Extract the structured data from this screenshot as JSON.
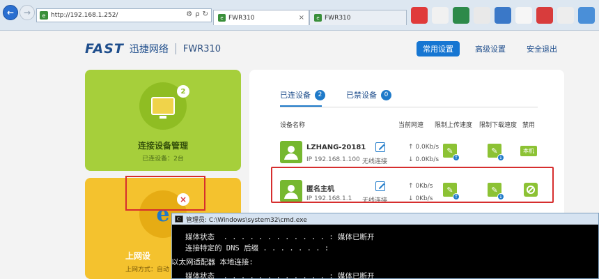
{
  "browser": {
    "address": "http://192.168.1.252/",
    "tabs": [
      {
        "label": "FWR310",
        "active": true
      },
      {
        "label": "FWR310",
        "active": false
      }
    ],
    "address_tools": [
      "⚙",
      "ρ",
      "↻"
    ]
  },
  "header": {
    "logo": "FAST",
    "brand_cn": "迅捷网络",
    "model": "FWR310",
    "nav": [
      "常用设置",
      "高级设置",
      "安全退出"
    ]
  },
  "tiles": {
    "devices": {
      "title": "连接设备管理",
      "subtitle": "已连设备：2台",
      "count": "2"
    },
    "internet": {
      "title": "上网设",
      "subtitle": "上网方式：自动"
    }
  },
  "panel": {
    "tabs": [
      {
        "label": "已连设备",
        "count": "2"
      },
      {
        "label": "已禁设备",
        "count": "0"
      }
    ],
    "columns": [
      "设备名称",
      "当前网速",
      "限制上传速度",
      "限制下载速度",
      "禁用"
    ],
    "rows": [
      {
        "name": "LZHANG-20181",
        "ip": "IP 192.168.1.100",
        "conn": "无线连接",
        "up": "↑ 0.0Kb/s",
        "down": "↓ 0.0Kb/s",
        "status": "本机"
      },
      {
        "name": "匿名主机",
        "ip": "IP 192.168.1.1",
        "conn": "无线连接",
        "up": "↑ 0Kb/s",
        "down": "↓ 0Kb/s",
        "status": ""
      }
    ]
  },
  "cmd": {
    "title": "管理员: C:\\Windows\\system32\\cmd.exe",
    "lines": [
      "   媒体状态  . . . . . . . . . . . . : 媒体已断开",
      "   连接特定的 DNS 后缀 . . . . . . . :",
      "以太网适配器 本地连接:",
      "   媒体状态  . . . . . . . . . . . . : 媒体已断开"
    ]
  },
  "colors": {
    "accent": "#1676d2",
    "tile_green": "#a6cf3b",
    "tile_yellow": "#f4c22e",
    "highlight": "#d62e2e"
  }
}
